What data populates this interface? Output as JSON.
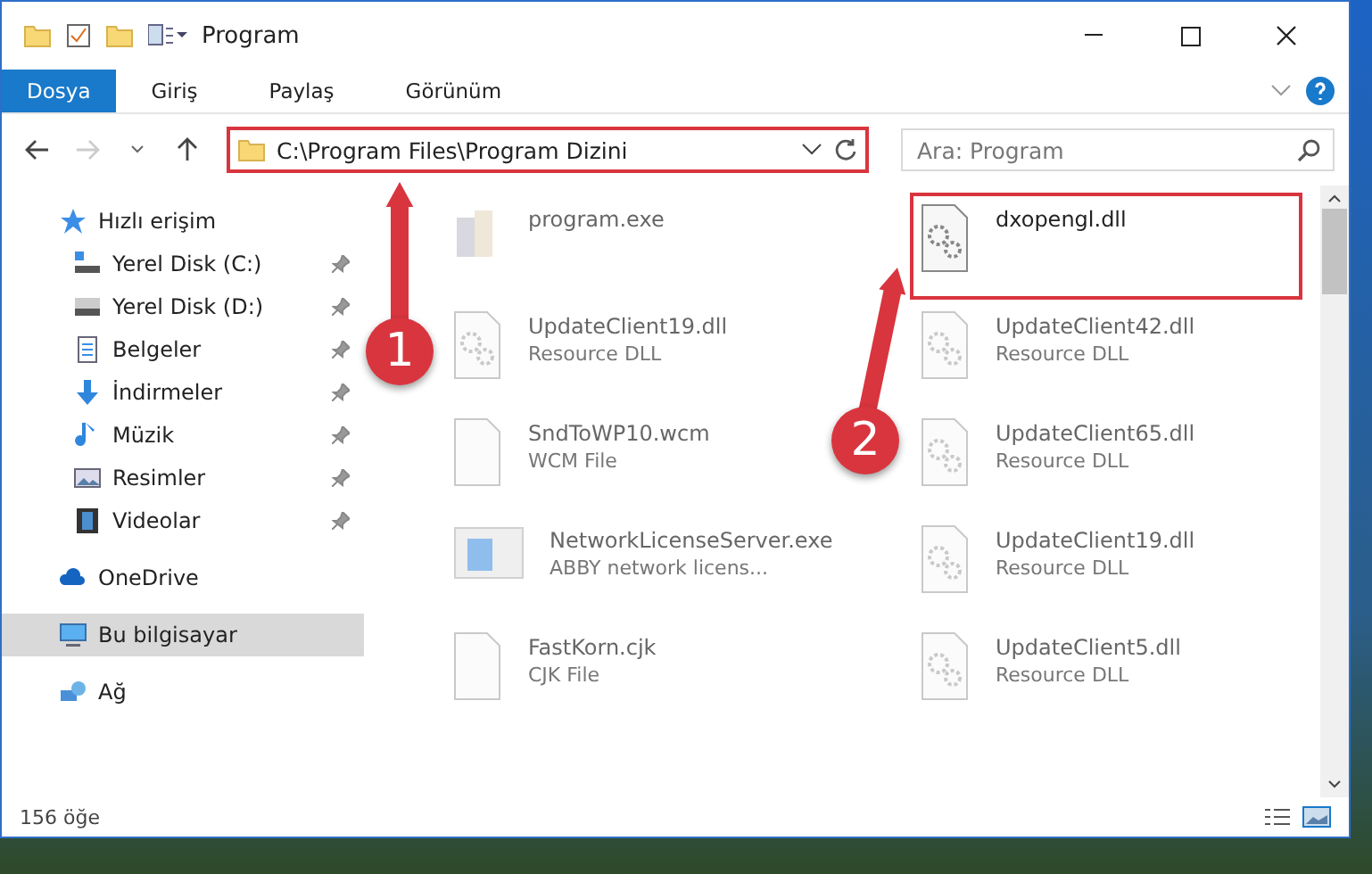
{
  "window": {
    "title": "Program"
  },
  "ribbon_tabs": [
    {
      "label": "Dosya",
      "selected": true
    },
    {
      "label": "Giriş",
      "selected": false
    },
    {
      "label": "Paylaş",
      "selected": false
    },
    {
      "label": "Görünüm",
      "selected": false
    }
  ],
  "address_bar": {
    "path": "C:\\Program Files\\Program Dizini",
    "highlighted": true
  },
  "search": {
    "placeholder": "Ara: Program"
  },
  "sidebar": {
    "items": [
      {
        "label": "Hızlı erişim",
        "kind": "star",
        "selected": false,
        "children": [
          {
            "label": "Yerel Disk (C:)",
            "kind": "drive-c",
            "pinned": true,
            "selected": false
          },
          {
            "label": "Yerel Disk (D:)",
            "kind": "drive",
            "pinned": true,
            "selected": false
          },
          {
            "label": "Belgeler",
            "kind": "document",
            "pinned": true,
            "selected": false
          },
          {
            "label": "İndirmeler",
            "kind": "download",
            "pinned": true,
            "selected": false
          },
          {
            "label": "Müzik",
            "kind": "music",
            "pinned": true,
            "selected": false
          },
          {
            "label": "Resimler",
            "kind": "pictures",
            "pinned": true,
            "selected": false
          },
          {
            "label": "Videolar",
            "kind": "videos",
            "pinned": true,
            "selected": false
          }
        ]
      },
      {
        "label": "OneDrive",
        "kind": "cloud",
        "selected": false
      },
      {
        "label": "Bu bilgisayar",
        "kind": "computer",
        "selected": true
      },
      {
        "label": "Ağ",
        "kind": "network",
        "selected": false
      }
    ]
  },
  "files": [
    {
      "name": "program.exe",
      "kind": "exe",
      "faded": true,
      "highlighted": false
    },
    {
      "name": "dxopengl.dll",
      "kind": "dll",
      "faded": false,
      "highlighted": true
    },
    {
      "name": "UpdateClient19.dll",
      "type": "Resource DLL",
      "kind": "dll",
      "faded": true,
      "highlighted": false
    },
    {
      "name": "UpdateClient42.dll",
      "type": "Resource DLL",
      "kind": "dll",
      "faded": true,
      "highlighted": false
    },
    {
      "name": "SndToWP10.wcm",
      "type": "WCM File",
      "kind": "blank",
      "faded": true,
      "highlighted": false
    },
    {
      "name": "UpdateClient65.dll",
      "type": "Resource DLL",
      "kind": "dll",
      "faded": true,
      "highlighted": false
    },
    {
      "name": "NetworkLicenseServer.exe",
      "type": "ABBY network licens...",
      "kind": "window",
      "faded": true,
      "highlighted": false
    },
    {
      "name": "UpdateClient19.dll",
      "type": "Resource DLL",
      "kind": "dll",
      "faded": true,
      "highlighted": false
    },
    {
      "name": "FastKorn.cjk",
      "type": "CJK File",
      "kind": "blank",
      "faded": true,
      "highlighted": false
    },
    {
      "name": "UpdateClient5.dll",
      "type": "Resource DLL",
      "kind": "dll",
      "faded": true,
      "highlighted": false
    }
  ],
  "annotations": [
    {
      "number": "1"
    },
    {
      "number": "2"
    }
  ],
  "status_bar": {
    "count": "156 öğe"
  }
}
